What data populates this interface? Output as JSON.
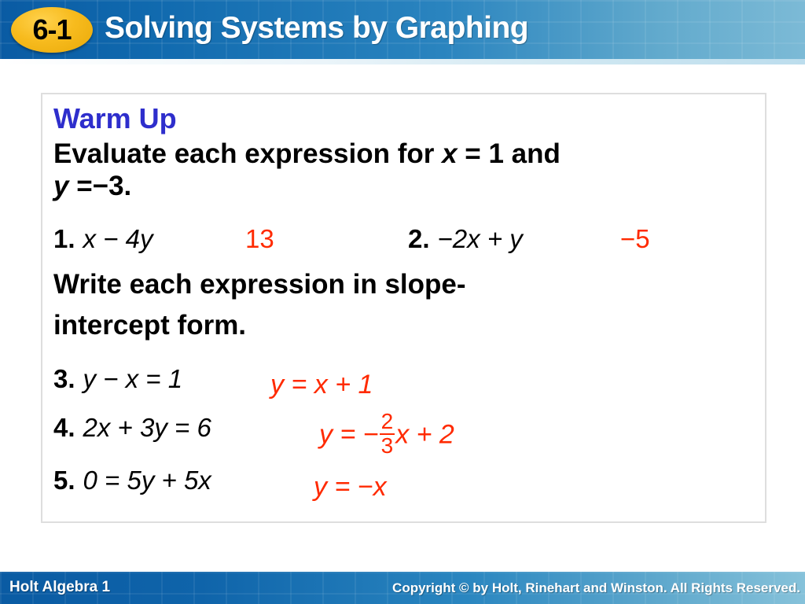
{
  "header": {
    "badge_label": "6-1",
    "title": "Solving Systems by Graphing",
    "bg_color_left": "#0a5ba3",
    "bg_color_right": "#7cbad6",
    "badge_color": "#f7bb1e"
  },
  "content": {
    "warmup_title": "Warm Up",
    "warmup_title_color": "#2E2ECC",
    "answer_color": "#FF2A00",
    "prompt_1_a": "Evaluate each expression for ",
    "prompt_1_x": "x",
    "prompt_1_b": " = 1 and",
    "prompt_2_y": "y",
    "prompt_2_b": " =−3.",
    "prompt_3": "Write each expression in slope-",
    "prompt_4": "intercept form.",
    "questions": [
      {
        "num": "1.",
        "expr_pre": " ",
        "expr": "x − 4y",
        "answer": "13"
      },
      {
        "num": "2.",
        "expr": "−2x + y",
        "answer": "−5"
      },
      {
        "num": "3.",
        "expr": "y − x = 1",
        "answer": "y = x + 1"
      },
      {
        "num": "4.",
        "expr": "2x + 3y = 6",
        "answer_lead": "y = −",
        "answer_frac_num": "2",
        "answer_frac_den": "3",
        "answer_tail": "x + 2"
      },
      {
        "num": "5.",
        "expr": "0 = 5y + 5x",
        "answer": "y = −x"
      }
    ]
  },
  "footer": {
    "brand": "Holt Algebra 1",
    "copyright": "Copyright © by Holt, Rinehart and Winston. All Rights Reserved.",
    "bg_color_left": "#0a5ba3",
    "bg_color_right": "#86c2da"
  }
}
